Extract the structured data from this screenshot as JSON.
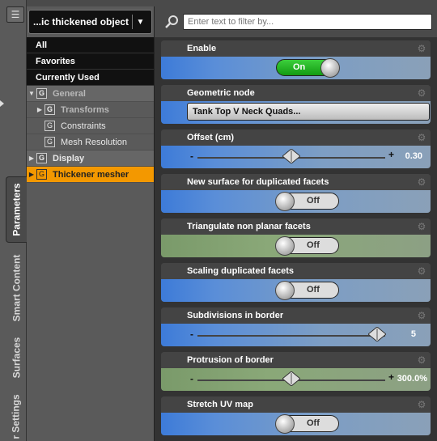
{
  "tabs": [
    {
      "label": "Parameters",
      "active": true
    },
    {
      "label": "Smart Content",
      "active": false
    },
    {
      "label": "Surfaces",
      "active": false
    },
    {
      "label": "r Settings",
      "active": false
    }
  ],
  "tree": {
    "object_name": "...ic thickened object",
    "quick_filters": [
      "All",
      "Favorites",
      "Currently Used"
    ],
    "groups": {
      "general": "General",
      "transforms": "Transforms",
      "constraints": "Constraints",
      "mesh_resolution": "Mesh Resolution",
      "display": "Display",
      "thickener_mesher": "Thickener mesher"
    },
    "group_icon_letter": "G"
  },
  "filter": {
    "placeholder": "Enter text to filter by..."
  },
  "properties": {
    "enable": {
      "label": "Enable",
      "value": "On"
    },
    "geometric_node": {
      "label": "Geometric node",
      "value": "Tank Top V Neck Quads..."
    },
    "offset": {
      "label": "Offset (cm)",
      "value": "0.30",
      "fraction": 0.5
    },
    "new_surface": {
      "label": "New surface for duplicated facets",
      "value": "Off"
    },
    "triangulate": {
      "label": "Triangulate non planar facets",
      "value": "Off"
    },
    "scaling": {
      "label": "Scaling duplicated facets",
      "value": "Off"
    },
    "subdivisions": {
      "label": "Subdivisions in border",
      "value": "5",
      "fraction": 1.0
    },
    "protrusion": {
      "label": "Protrusion of border",
      "value": "300.0%",
      "fraction": 0.5
    },
    "stretch_uv": {
      "label": "Stretch UV map",
      "value": "Off"
    }
  },
  "colors": {
    "selection": "#f39800",
    "toggle_on": "#22b022",
    "blue_band": "#3d7bd8",
    "green_band": "#7a9a6a"
  },
  "icons": {
    "menu": "panel-menu-icon",
    "search": "search-icon",
    "gear": "gear-icon",
    "dropdown": "chevron-down-icon"
  },
  "glyphs": {
    "minus": "-",
    "plus": "+",
    "expand": "▶",
    "collapse": "▼"
  }
}
